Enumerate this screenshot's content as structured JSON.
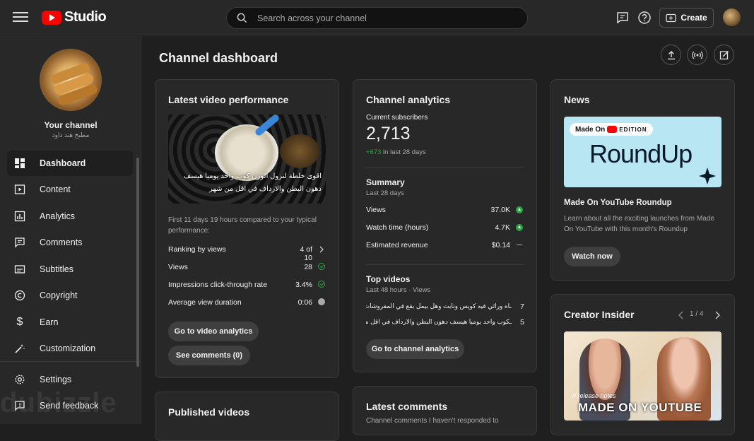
{
  "app": {
    "logo_text": "Studio"
  },
  "search": {
    "placeholder": "Search across your channel"
  },
  "header": {
    "create_label": "Create"
  },
  "sidebar": {
    "channel_label": "Your channel",
    "channel_name": "مطبخ هند داود",
    "items": [
      {
        "label": "Dashboard",
        "icon": "dashboard-icon",
        "active": true
      },
      {
        "label": "Content",
        "icon": "content-icon"
      },
      {
        "label": "Analytics",
        "icon": "analytics-icon"
      },
      {
        "label": "Comments",
        "icon": "comments-icon"
      },
      {
        "label": "Subtitles",
        "icon": "subtitles-icon"
      },
      {
        "label": "Copyright",
        "icon": "copyright-icon"
      },
      {
        "label": "Earn",
        "icon": "earn-icon"
      },
      {
        "label": "Customization",
        "icon": "customization-icon"
      }
    ],
    "bottom": [
      {
        "label": "Settings",
        "icon": "gear-icon"
      },
      {
        "label": "Send feedback",
        "icon": "feedback-icon"
      }
    ]
  },
  "page": {
    "title": "Channel dashboard"
  },
  "latest_video": {
    "title": "Latest video performance",
    "thumb_caption_1": "اقوى خلطة لنزول الوزن كوب واحد يوميا هيسف",
    "thumb_caption_2": "دهون البطن والارداف في اقل من شهر",
    "compare_text": "First 11 days 19 hours compared to your typical performance:",
    "metrics": [
      {
        "label": "Ranking by views",
        "value": "4 of 10"
      },
      {
        "label": "Views",
        "value": "28"
      },
      {
        "label": "Impressions click-through rate",
        "value": "3.4%"
      },
      {
        "label": "Average view duration",
        "value": "0:06"
      }
    ],
    "analytics_button": "Go to video analytics",
    "comments_button": "See comments (0)"
  },
  "channel_analytics": {
    "title": "Channel analytics",
    "subscribers_label": "Current subscribers",
    "subscribers_value": "2,713",
    "subscribers_change": "+673",
    "subscribers_change_suffix": "in last 28 days",
    "summary_title": "Summary",
    "summary_period": "Last 28 days",
    "summary": [
      {
        "label": "Views",
        "value": "37.0K"
      },
      {
        "label": "Watch time (hours)",
        "value": "4.7K"
      },
      {
        "label": "Estimated revenue",
        "value": "$0.14"
      }
    ],
    "top_videos_title": "Top videos",
    "top_videos_period": "Last 48 hours · Views",
    "top_videos": [
      {
        "title": "ـاه ورائي فيه كويس وتابت وهل بيمل بقع في المفروشات ولا لا",
        "views": "7"
      },
      {
        "title": "ـكوب واحد يوميا هيسف دهون البطن والارداف في اقل من شهر",
        "views": "5"
      }
    ],
    "button": "Go to channel analytics"
  },
  "news": {
    "title": "News",
    "badge_made_on": "Made On",
    "badge_edition": "EDITION",
    "image_text": "RoundUp",
    "headline": "Made On YouTube Roundup",
    "body": "Learn about all the exciting launches from Made On YouTube with this month's Roundup",
    "button": "Watch now"
  },
  "creator_insider": {
    "title": "Creator Insider",
    "pager": "1 / 4",
    "image_small": "// release notes",
    "image_big": "MADE ON YOUTUBE"
  },
  "published_videos": {
    "title": "Published videos"
  },
  "latest_comments": {
    "title": "Latest comments",
    "subtitle": "Channel comments I haven't responded to"
  },
  "watermark": "dubizzle",
  "colors": {
    "accent_red": "#ff0000",
    "positive_green": "#2ba640",
    "background": "#1f1f1f",
    "card": "#282828"
  }
}
